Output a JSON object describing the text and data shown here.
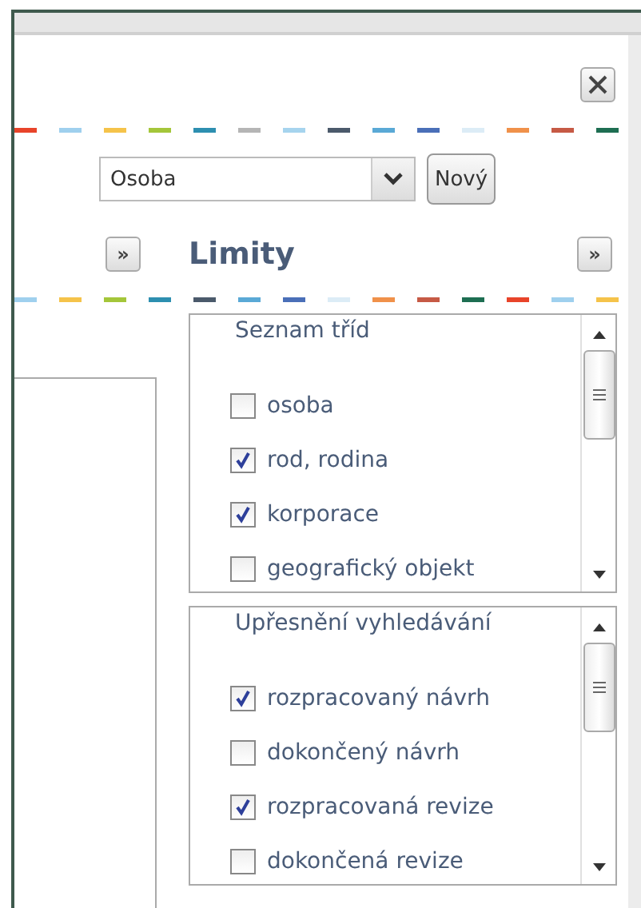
{
  "select": {
    "value": "Osoba"
  },
  "new_button": "Nový",
  "toggle_buttons": [
    "»",
    "»"
  ],
  "title": "Limity",
  "lists": [
    {
      "title": "Seznam tříd",
      "items": [
        {
          "label": "osoba",
          "checked": false
        },
        {
          "label": "rod, rodina",
          "checked": true
        },
        {
          "label": "korporace",
          "checked": true
        },
        {
          "label": "geografický objekt",
          "checked": false
        }
      ]
    },
    {
      "title": "Upřesnění vyhledávání",
      "items": [
        {
          "label": "rozpracovaný návrh",
          "checked": true
        },
        {
          "label": "dokončený návrh",
          "checked": false
        },
        {
          "label": "rozpracovaná revize",
          "checked": true
        },
        {
          "label": "dokončená revize",
          "checked": false
        }
      ]
    }
  ]
}
